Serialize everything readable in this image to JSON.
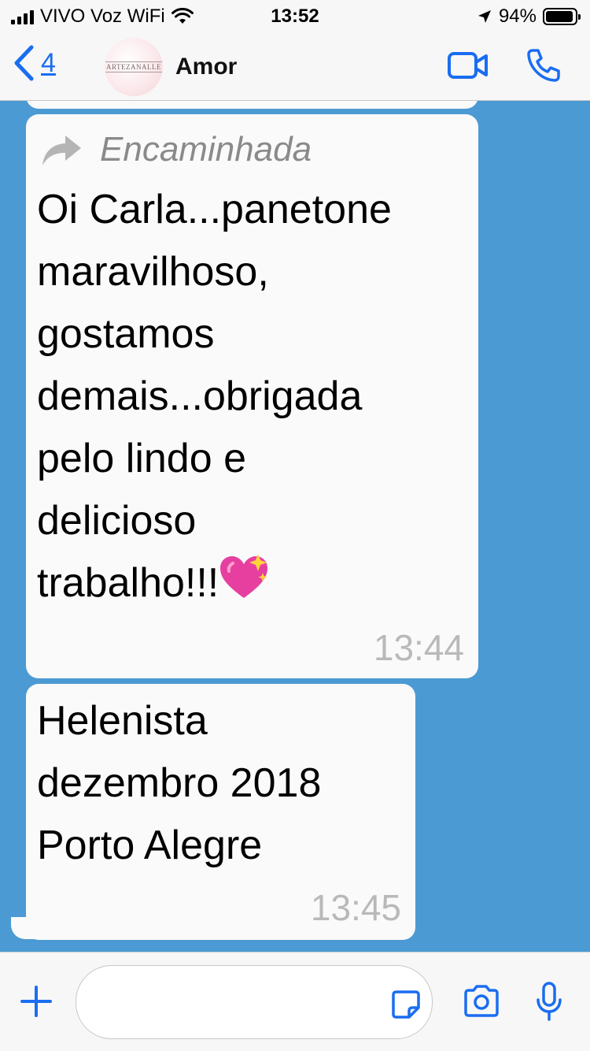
{
  "status_bar": {
    "carrier": "VIVO Voz WiFi",
    "time": "13:52",
    "battery": "94%",
    "battery_level": 0.94
  },
  "header": {
    "back_count": "4",
    "avatar_text": "ARTEZANALLE",
    "contact_name": "Amor"
  },
  "messages": [
    {
      "forwarded_label": "Encaminhada",
      "text": "Oi Carla...panetone\nmaravilhoso,\ngostamos\ndemais...obrigada\npelo lindo e\ndelicioso\ntrabalho!!!",
      "time": "13:44"
    },
    {
      "text": "Helenista\ndezembro 2018\nPorto Alegre",
      "time": "13:45"
    }
  ],
  "icons": {
    "back": "chevron-left-icon",
    "video": "video-camera-icon",
    "call": "phone-icon",
    "forward": "forward-arrow-icon",
    "heart": "sparkling-heart-icon",
    "plus": "plus-icon",
    "sticker": "sticker-icon",
    "camera": "camera-icon",
    "mic": "microphone-icon"
  },
  "colors": {
    "accent": "#1a6df0",
    "chat_background": "#4b9ad3",
    "bubble": "#fafafa",
    "timestamp": "#b9b9b9"
  }
}
